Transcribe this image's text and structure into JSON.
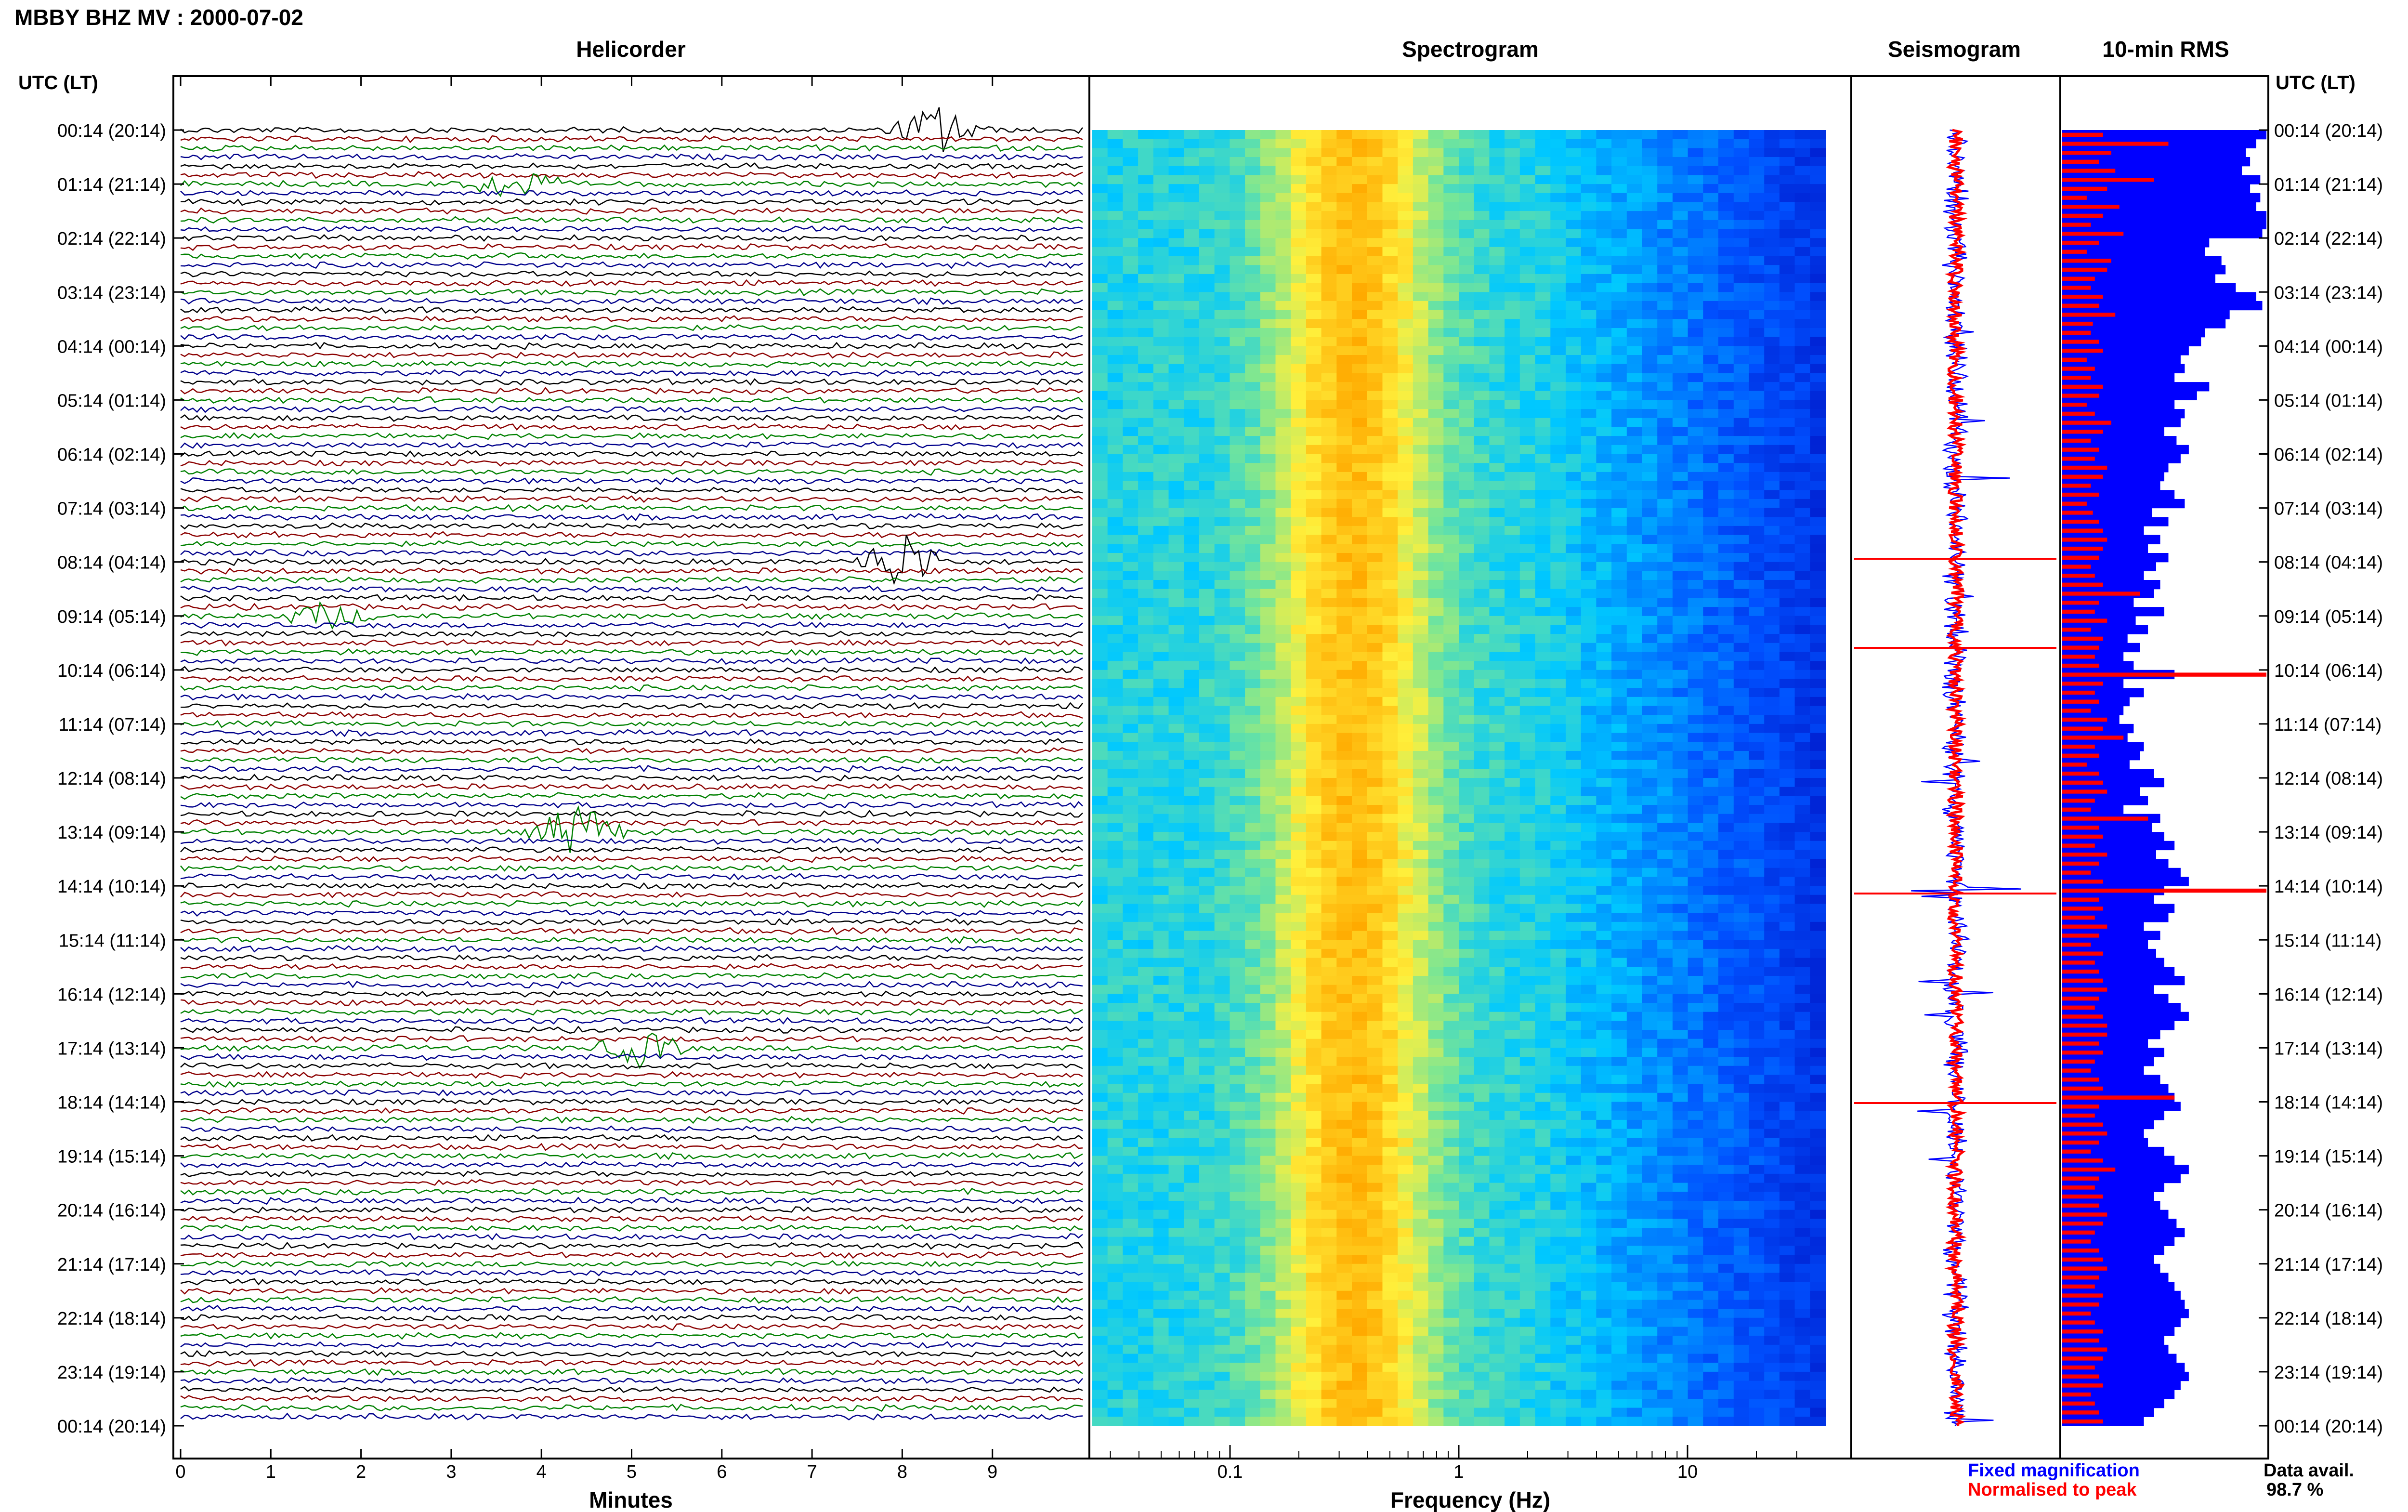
{
  "figure_title": "MBBY BHZ MV : 2000-07-02",
  "panels": {
    "helicorder": "Helicorder",
    "spectrogram": "Spectrogram",
    "seismogram": "Seismogram",
    "rms": "10-min RMS"
  },
  "y_axis_header": "UTC (LT)",
  "hour_labels": [
    "00:14 (20:14)",
    "01:14 (21:14)",
    "02:14 (22:14)",
    "03:14 (23:14)",
    "04:14 (00:14)",
    "05:14 (01:14)",
    "06:14 (02:14)",
    "07:14 (03:14)",
    "08:14 (04:14)",
    "09:14 (05:14)",
    "10:14 (06:14)",
    "11:14 (07:14)",
    "12:14 (08:14)",
    "13:14 (09:14)",
    "14:14 (10:14)",
    "15:14 (11:14)",
    "16:14 (12:14)",
    "17:14 (13:14)",
    "18:14 (14:14)",
    "19:14 (15:14)",
    "20:14 (16:14)",
    "21:14 (17:14)",
    "22:14 (18:14)",
    "23:14 (19:14)",
    "00:14 (20:14)"
  ],
  "helicorder_xaxis": {
    "label": "Minutes",
    "ticks": [
      "0",
      "1",
      "2",
      "3",
      "4",
      "5",
      "6",
      "7",
      "8",
      "9"
    ]
  },
  "spectrogram_xaxis": {
    "label": "Frequency (Hz)",
    "ticks": [
      "0.1",
      "1",
      "10"
    ],
    "scale": "log"
  },
  "legend": {
    "fixed": "Fixed magnification",
    "normalised": "Normalised to peak",
    "fixed_color": "#0000ff",
    "normalised_color": "#ff0000"
  },
  "data_avail": {
    "label": "Data avail.",
    "value": "98.7 %"
  },
  "colors": {
    "trace_cycle": [
      "#000000",
      "#8b0000",
      "#008000",
      "#00008b"
    ],
    "rms_fixed": "#0000ff",
    "rms_normalised": "#ff0000"
  },
  "chart_data": [
    {
      "type": "line",
      "title": "Helicorder",
      "xlabel": "Minutes",
      "xlim": [
        0,
        10
      ],
      "rows": 144,
      "events": [
        {
          "hour": 0,
          "minute": 8.4,
          "amplitude": 3.0
        },
        {
          "hour": 1,
          "minute": 3.7,
          "amplitude": 2.0
        },
        {
          "hour": 8,
          "minute": 8.0,
          "amplitude": 3.5
        },
        {
          "hour": 9,
          "minute": 1.6,
          "amplitude": 1.5
        },
        {
          "hour": 13,
          "minute": 4.4,
          "amplitude": 3.2
        },
        {
          "hour": 17,
          "minute": 5.1,
          "amplitude": 2.0
        }
      ]
    },
    {
      "type": "heatmap",
      "title": "Spectrogram",
      "xlabel": "Frequency (Hz)",
      "xlim": [
        0.025,
        40
      ],
      "xscale": "log",
      "peak_band_hz": [
        0.2,
        0.5
      ]
    },
    {
      "type": "line",
      "title": "Seismogram",
      "series": [
        {
          "name": "Fixed magnification",
          "color": "#0000ff"
        },
        {
          "name": "Normalised to peak",
          "color": "#ff0000"
        }
      ]
    },
    {
      "type": "bar",
      "title": "10-min RMS",
      "orientation": "horizontal",
      "series": [
        {
          "name": "Fixed magnification",
          "color": "#0000ff",
          "values": [
            1.0,
            0.95,
            0.9,
            0.92,
            0.88,
            0.97,
            0.92,
            0.97,
            0.95,
            1.0,
            1.0,
            0.98,
            0.72,
            0.7,
            0.78,
            0.8,
            0.75,
            0.85,
            0.95,
            0.98,
            0.82,
            0.8,
            0.7,
            0.68,
            0.62,
            0.58,
            0.6,
            0.55,
            0.72,
            0.66,
            0.55,
            0.6,
            0.58,
            0.5,
            0.56,
            0.62,
            0.58,
            0.52,
            0.5,
            0.48,
            0.55,
            0.6,
            0.44,
            0.52,
            0.4,
            0.48,
            0.42,
            0.52,
            0.46,
            0.4,
            0.48,
            0.45,
            0.35,
            0.5,
            0.36,
            0.42,
            0.32,
            0.38,
            0.3,
            0.35,
            0.55,
            0.3,
            0.4,
            0.33,
            0.3,
            0.28,
            0.35,
            0.32,
            0.4,
            0.38,
            0.33,
            0.45,
            0.5,
            0.38,
            0.42,
            0.3,
            0.48,
            0.44,
            0.5,
            0.55,
            0.46,
            0.52,
            0.58,
            0.62,
            0.5,
            0.45,
            0.55,
            0.52,
            0.4,
            0.48,
            0.42,
            0.46,
            0.5,
            0.55,
            0.6,
            0.45,
            0.52,
            0.58,
            0.62,
            0.55,
            0.48,
            0.42,
            0.5,
            0.45,
            0.4,
            0.48,
            0.52,
            0.55,
            0.58,
            0.5,
            0.45,
            0.4,
            0.42,
            0.5,
            0.55,
            0.62,
            0.58,
            0.5,
            0.45,
            0.48,
            0.52,
            0.56,
            0.6,
            0.55,
            0.5,
            0.45,
            0.48,
            0.52,
            0.55,
            0.58,
            0.6,
            0.62,
            0.58,
            0.55,
            0.5,
            0.52,
            0.56,
            0.6,
            0.62,
            0.58,
            0.55,
            0.5,
            0.45,
            0.4
          ]
        },
        {
          "name": "Normalised to peak",
          "color": "#ff0000",
          "values": [
            0.2,
            0.52,
            0.24,
            0.18,
            0.26,
            0.45,
            0.22,
            0.12,
            0.28,
            0.2,
            0.14,
            0.3,
            0.18,
            0.12,
            0.24,
            0.22,
            0.16,
            0.14,
            0.2,
            0.18,
            0.26,
            0.15,
            0.14,
            0.18,
            0.2,
            0.12,
            0.16,
            0.14,
            0.2,
            0.18,
            0.12,
            0.16,
            0.24,
            0.2,
            0.14,
            0.18,
            0.16,
            0.22,
            0.2,
            0.14,
            0.18,
            0.12,
            0.15,
            0.18,
            0.2,
            0.22,
            0.2,
            0.18,
            0.14,
            0.16,
            0.2,
            0.38,
            0.18,
            0.16,
            0.22,
            0.14,
            0.2,
            0.18,
            0.16,
            0.18,
            1.0,
            0.2,
            0.16,
            0.18,
            0.14,
            0.22,
            0.2,
            0.3,
            0.16,
            0.18,
            0.12,
            0.18,
            0.2,
            0.22,
            0.16,
            0.14,
            0.42,
            0.18,
            0.2,
            0.16,
            0.22,
            0.18,
            0.14,
            0.2,
            1.0,
            0.18,
            0.2,
            0.16,
            0.22,
            0.18,
            0.14,
            0.2,
            0.16,
            0.18,
            0.2,
            0.22,
            0.18,
            0.16,
            0.2,
            0.22,
            0.22,
            0.18,
            0.2,
            0.16,
            0.14,
            0.18,
            0.2,
            0.55,
            0.18,
            0.16,
            0.2,
            0.22,
            0.18,
            0.14,
            0.2,
            0.26,
            0.18,
            0.16,
            0.2,
            0.18,
            0.22,
            0.2,
            0.16,
            0.14,
            0.18,
            0.2,
            0.22,
            0.18,
            0.16,
            0.2,
            0.18,
            0.14,
            0.16,
            0.2,
            0.18,
            0.22,
            0.2,
            0.16,
            0.18,
            0.2,
            0.14,
            0.16,
            0.18,
            0.2
          ]
        }
      ]
    }
  ]
}
